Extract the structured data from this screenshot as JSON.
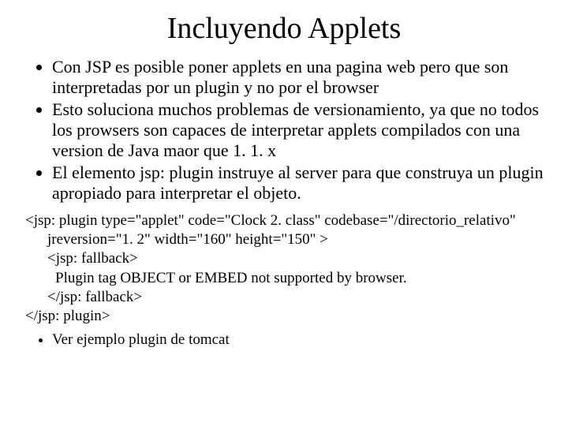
{
  "title": "Incluyendo Applets",
  "bullets": [
    "Con JSP es posible poner applets en una pagina web pero que son interpretadas por un plugin y no por el browser",
    "Esto soluciona muchos problemas de versionamiento, ya que no todos los prowsers son capaces de interpretar applets compilados con una version de Java maor que 1. 1. x",
    "El elemento jsp: plugin instruye al server para que construya un plugin apropiado para interpretar el objeto."
  ],
  "code": {
    "l0": "<jsp: plugin type=\"applet\" code=\"Clock 2. class\" codebase=\"/directorio_relativo\"",
    "l1": "jreversion=\"1. 2\" width=\"160\" height=\"150\" >",
    "l2": "<jsp: fallback>",
    "l3": "Plugin tag OBJECT or EMBED not supported by browser.",
    "l4": "</jsp: fallback>",
    "l5": "</jsp: plugin>"
  },
  "trailing_bullet": "Ver ejemplo plugin de tomcat"
}
